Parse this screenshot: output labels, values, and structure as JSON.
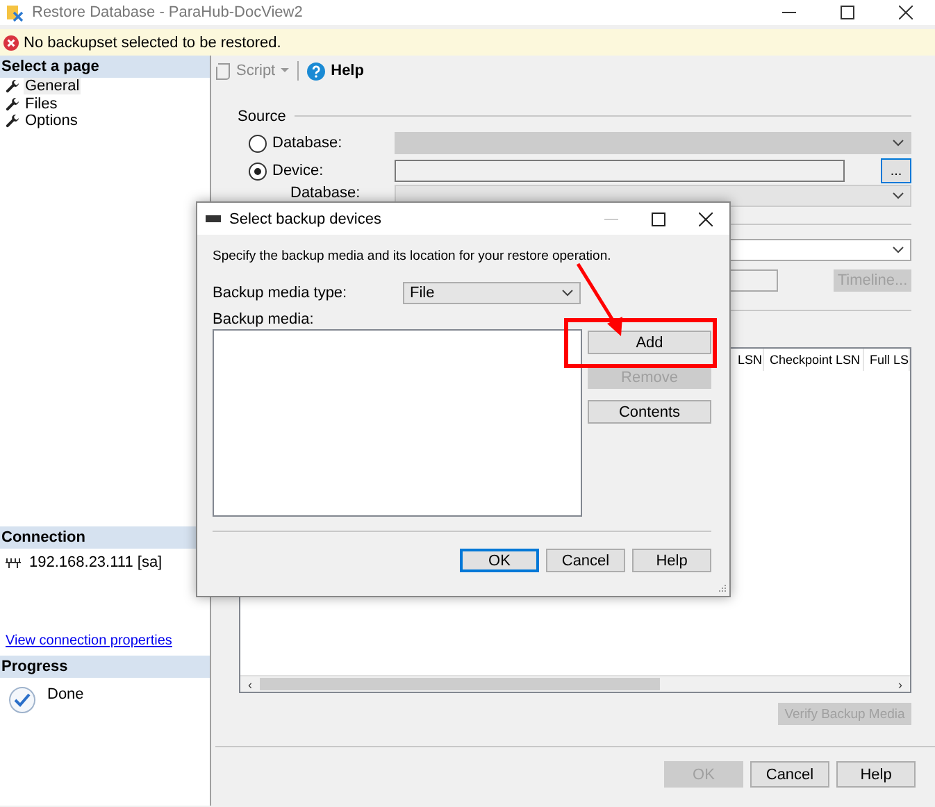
{
  "window": {
    "title": "Restore Database - ParaHub-DocView2"
  },
  "warning": {
    "text": "No backupset selected to be restored."
  },
  "sidebar": {
    "select_page": {
      "header": "Select a page",
      "items": [
        {
          "label": "General",
          "selected": true
        },
        {
          "label": "Files",
          "selected": false
        },
        {
          "label": "Options",
          "selected": false
        }
      ]
    },
    "connection": {
      "header": "Connection",
      "server": "192.168.23.111 [sa]",
      "link": "View connection properties"
    },
    "progress": {
      "header": "Progress",
      "status": "Done"
    }
  },
  "toolbar": {
    "script": "Script",
    "help": "Help"
  },
  "source": {
    "label": "Source",
    "options": [
      {
        "label": "Database:",
        "selected": false
      },
      {
        "label": "Device:",
        "selected": true
      }
    ],
    "database_label": "Database:",
    "browse_button": "..."
  },
  "timeline_button": {
    "label": "Timeline...",
    "disabled": true
  },
  "grid": {
    "columns": [
      "LSN",
      "Checkpoint LSN",
      "Full LS"
    ],
    "scroll_left": "‹",
    "scroll_right": "›"
  },
  "verify_button": {
    "label": "Verify Backup Media",
    "disabled": true
  },
  "buttons": [
    {
      "label": "OK",
      "disabled": true
    },
    {
      "label": "Cancel",
      "disabled": false
    },
    {
      "label": "Help",
      "disabled": false
    }
  ],
  "dialog": {
    "title": "Select backup devices",
    "description": "Specify the backup media and its location for your restore operation.",
    "media_type_label": "Backup media type:",
    "media_type_value": "File",
    "media_label": "Backup media:",
    "side_buttons": [
      {
        "label": "Add",
        "disabled": false
      },
      {
        "label": "Remove",
        "disabled": true
      },
      {
        "label": "Contents",
        "disabled": false
      }
    ],
    "buttons": [
      {
        "label": "OK",
        "default": true
      },
      {
        "label": "Cancel",
        "default": false
      },
      {
        "label": "Help",
        "default": false
      }
    ]
  }
}
